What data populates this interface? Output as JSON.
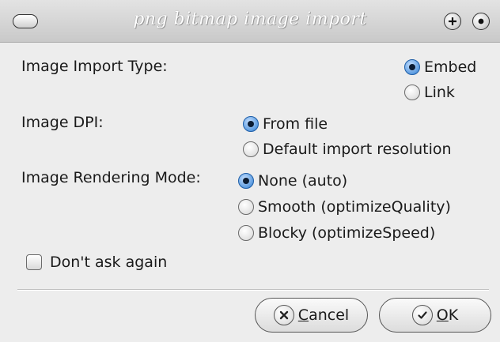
{
  "window": {
    "title": "png bitmap image import"
  },
  "import_type": {
    "label": "Image Import Type:",
    "options": [
      {
        "label": "Embed",
        "selected": true
      },
      {
        "label": "Link",
        "selected": false
      }
    ]
  },
  "dpi": {
    "label": "Image DPI:",
    "options": [
      {
        "label": "From file",
        "selected": true
      },
      {
        "label": "Default import resolution",
        "selected": false
      }
    ]
  },
  "rendering": {
    "label": "Image Rendering Mode:",
    "options": [
      {
        "label": "None (auto)",
        "selected": true
      },
      {
        "label": "Smooth (optimizeQuality)",
        "selected": false
      },
      {
        "label": "Blocky (optimizeSpeed)",
        "selected": false
      }
    ]
  },
  "dont_ask": {
    "label": "Don't ask again",
    "checked": false
  },
  "buttons": {
    "cancel": {
      "mnemonic": "C",
      "rest": "ancel"
    },
    "ok": {
      "mnemonic": "O",
      "rest": "K"
    }
  },
  "icons": {
    "menu": "window-menu-icon",
    "maximize": "plus-icon",
    "close": "dot-icon",
    "cancel": "x-circle-icon",
    "ok": "checkmark-icon"
  },
  "colors": {
    "radio_selected": "#2f6fbd",
    "background": "#ededed"
  }
}
